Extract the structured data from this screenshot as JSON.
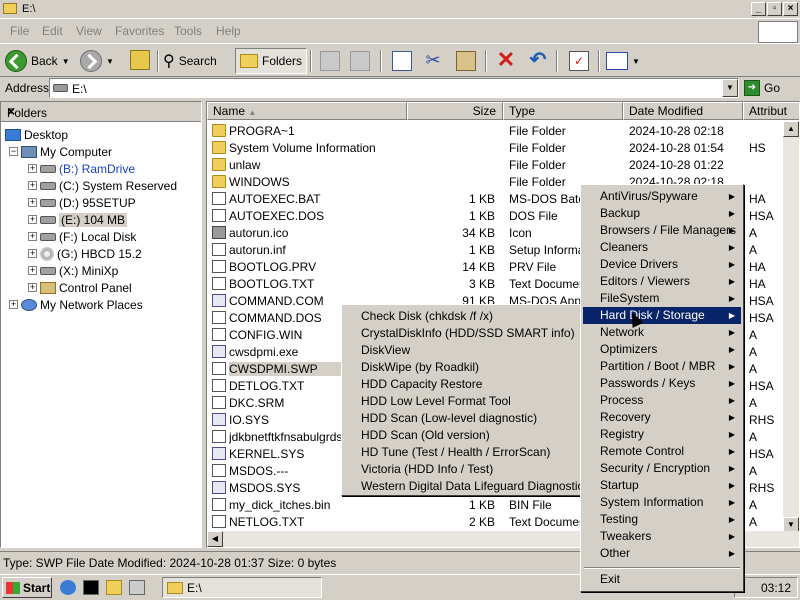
{
  "window": {
    "title": "E:\\"
  },
  "menubar": [
    "File",
    "Edit",
    "View",
    "Favorites",
    "Tools",
    "Help"
  ],
  "toolbar": {
    "back_label": "Back",
    "search_label": "Search",
    "folders_label": "Folders"
  },
  "address": {
    "label": "Address",
    "value": "E:\\",
    "go_label": "Go"
  },
  "folders_pane": {
    "title": "Folders",
    "tree": [
      {
        "label": "Desktop"
      },
      {
        "label": "My Computer"
      },
      {
        "label": "(B:) RamDrive"
      },
      {
        "label": "(C:) System Reserved"
      },
      {
        "label": "(D:) 95SETUP"
      },
      {
        "label": "(E:) 104 MB"
      },
      {
        "label": "(F:) Local Disk"
      },
      {
        "label": "(G:) HBCD 15.2"
      },
      {
        "label": "(X:) MiniXp"
      },
      {
        "label": "Control Panel"
      },
      {
        "label": "My Network Places"
      }
    ]
  },
  "columns": [
    "Name",
    "Size",
    "Type",
    "Date Modified",
    "Attribut"
  ],
  "files": [
    {
      "name": "PROGRA~1",
      "size": "",
      "type": "File Folder",
      "date": "2024-10-28 02:18",
      "attr": ""
    },
    {
      "name": "System Volume Information",
      "size": "",
      "type": "File Folder",
      "date": "2024-10-28 01:54",
      "attr": "HS"
    },
    {
      "name": "unlaw",
      "size": "",
      "type": "File Folder",
      "date": "2024-10-28 01:22",
      "attr": ""
    },
    {
      "name": "WINDOWS",
      "size": "",
      "type": "File Folder",
      "date": "2024-10-28 02:18",
      "attr": ""
    },
    {
      "name": "AUTOEXEC.BAT",
      "size": "1 KB",
      "type": "MS-DOS Batch",
      "date": "",
      "attr": "HA"
    },
    {
      "name": "AUTOEXEC.DOS",
      "size": "1 KB",
      "type": "DOS File",
      "date": "",
      "attr": "HSA"
    },
    {
      "name": "autorun.ico",
      "size": "34 KB",
      "type": "Icon",
      "date": "",
      "attr": "A"
    },
    {
      "name": "autorun.inf",
      "size": "1 KB",
      "type": "Setup Informati",
      "date": "",
      "attr": "A"
    },
    {
      "name": "BOOTLOG.PRV",
      "size": "14 KB",
      "type": "PRV File",
      "date": "",
      "attr": "HA"
    },
    {
      "name": "BOOTLOG.TXT",
      "size": "3 KB",
      "type": "Text Document",
      "date": "",
      "attr": "HA"
    },
    {
      "name": "COMMAND.COM",
      "size": "91 KB",
      "type": "MS-DOS Applic",
      "date": "",
      "attr": "HSA"
    },
    {
      "name": "COMMAND.DOS",
      "size": "",
      "type": "",
      "date": "",
      "attr": "HSA"
    },
    {
      "name": "CONFIG.WIN",
      "size": "",
      "type": "",
      "date": "",
      "attr": "A"
    },
    {
      "name": "cwsdpmi.exe",
      "size": "",
      "type": "",
      "date": "",
      "attr": "A"
    },
    {
      "name": "CWSDPMI.SWP",
      "size": "",
      "type": "",
      "date": "",
      "attr": "A"
    },
    {
      "name": "DETLOG.TXT",
      "size": "",
      "type": "",
      "date": "",
      "attr": "HSA"
    },
    {
      "name": "DKC.SRM",
      "size": "",
      "type": "",
      "date": "",
      "attr": "A"
    },
    {
      "name": "IO.SYS",
      "size": "",
      "type": "",
      "date": "",
      "attr": "RHS"
    },
    {
      "name": "jdkbnetftkfnsabulgrdsajga",
      "size": "",
      "type": "",
      "date": "",
      "attr": "A"
    },
    {
      "name": "KERNEL.SYS",
      "size": "",
      "type": "",
      "date": "",
      "attr": "HSA"
    },
    {
      "name": "MSDOS.---",
      "size": "",
      "type": "",
      "date": "",
      "attr": "A"
    },
    {
      "name": "MSDOS.SYS",
      "size": "",
      "type": "",
      "date": "",
      "attr": "RHS"
    },
    {
      "name": "my_dick_itches.bin",
      "size": "1 KB",
      "type": "BIN File",
      "date": "",
      "attr": "A"
    },
    {
      "name": "NETLOG.TXT",
      "size": "2 KB",
      "type": "Text Document",
      "date": "",
      "attr": "A"
    }
  ],
  "status": "Type: SWP File Date Modified: 2024-10-28 01:37 Size: 0 bytes",
  "taskbar": {
    "start_label": "Start",
    "task_label": "E:\\",
    "clock": "03:12"
  },
  "main_menu": {
    "items": [
      "AntiVirus/Spyware",
      "Backup",
      "Browsers / File Managers",
      "Cleaners",
      "Device Drivers",
      "Editors / Viewers",
      "FileSystem",
      "Hard Disk / Storage",
      "Network",
      "Optimizers",
      "Partition / Boot / MBR",
      "Passwords / Keys",
      "Process",
      "Recovery",
      "Registry",
      "Remote Control",
      "Security / Encryption",
      "Startup",
      "System Information",
      "Testing",
      "Tweakers",
      "Other"
    ],
    "exit_label": "Exit"
  },
  "sub_menu": {
    "items": [
      "Check Disk (chkdsk /f /x)",
      "CrystalDiskInfo (HDD/SSD SMART info)",
      "DiskView",
      "DiskWipe (by Roadkil)",
      "HDD Capacity Restore",
      "HDD Low Level Format Tool",
      "HDD Scan (Low-level diagnostic)",
      "HDD Scan (Old version)",
      "HD Tune (Test / Health / ErrorScan)",
      "Victoria (HDD Info / Test)",
      "Western Digital Data Lifeguard Diagnostic"
    ]
  }
}
